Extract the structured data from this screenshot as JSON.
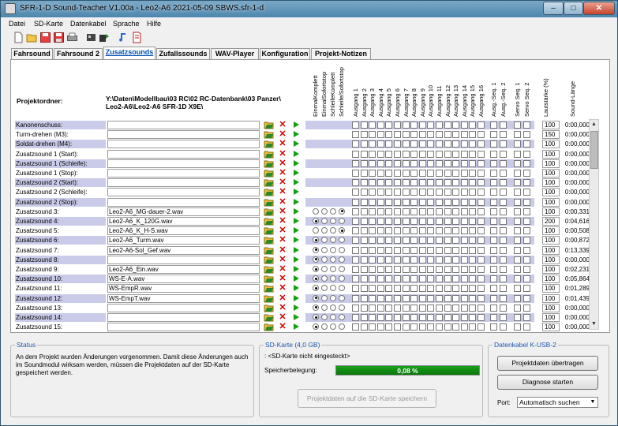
{
  "window": {
    "title": "SFR-1-D Sound-Teacher V1.00a - Leo2-A6 2021-05-09 SBWS.sfr-1-d",
    "min_label": "–",
    "max_label": "□",
    "close_label": "✕"
  },
  "menu": [
    "Datei",
    "SD-Karte",
    "Datenkabel",
    "Sprache",
    "Hilfe"
  ],
  "toolbar_icons": [
    "new-file-icon",
    "open-folder-icon",
    "save-icon",
    "save-as-icon",
    "print-icon",
    "module-icon",
    "export-icon",
    "music-note-icon",
    "document-icon"
  ],
  "tabs": [
    {
      "label": "Fahrsound",
      "active": false
    },
    {
      "label": "Fahrsound 2",
      "active": false
    },
    {
      "label": "Zusatzsounds",
      "active": true
    },
    {
      "label": "Zufallssounds",
      "active": false
    },
    {
      "label": "WAV-Player",
      "active": false
    },
    {
      "label": "Konfiguration",
      "active": false
    },
    {
      "label": "Projekt-Notizen",
      "active": false
    }
  ],
  "project": {
    "label": "Projektordner:",
    "path_line1": "Y:\\Daten\\Modellbau\\03 RC\\02 RC-Datenbank\\03 Panzer\\",
    "path_line2": "Leo2-A6\\Leo2-A6 SFR-1D X9E\\"
  },
  "headers": {
    "modes": [
      "EinmalKomplett",
      "EinmalSofortstop",
      "SchleifeKomplett",
      "Schleife/Sofortstop"
    ],
    "ausgang": [
      "Ausgang 1",
      "Ausgang 2",
      "Ausgang 3",
      "Ausgang 4",
      "Ausgang 5",
      "Ausgang 6",
      "Ausgang 7",
      "Ausgang 8",
      "Ausgang 9",
      "Ausgang 10",
      "Ausgang 11",
      "Ausgang 12",
      "Ausgang 13",
      "Ausgang 14",
      "Ausgang 15",
      "Ausgang 16"
    ],
    "ausgseq": [
      "Ausg.-Seq. 1",
      "Ausg.-Seq. 2"
    ],
    "servoseq": [
      "Servo Seq. 1",
      "Servo Seq. 2"
    ],
    "volume": "Lautstärke (%)",
    "length": "Sound-Länge"
  },
  "rows": [
    {
      "label": "Kanonenschuss:",
      "file": "",
      "mode": null,
      "volume": "100",
      "length": "0:00,000"
    },
    {
      "label": "Turm-drehen (M3):",
      "file": "",
      "mode": null,
      "volume": "150",
      "length": "0:00,000"
    },
    {
      "label": "Soldat-drehen (M4):",
      "file": "",
      "mode": null,
      "volume": "100",
      "length": "0:00,000"
    },
    {
      "label": "Zusatzsound 1 (Start):",
      "file": "",
      "mode": null,
      "volume": "100",
      "length": "0:00,000"
    },
    {
      "label": "Zusatzsound 1 (Schleife):",
      "file": "",
      "mode": null,
      "volume": "100",
      "length": "0:00,000"
    },
    {
      "label": "Zusatzsound 1 (Stop):",
      "file": "",
      "mode": null,
      "volume": "100",
      "length": "0:00,000"
    },
    {
      "label": "Zusatzsound 2 (Start):",
      "file": "",
      "mode": null,
      "volume": "100",
      "length": "0:00,000"
    },
    {
      "label": "Zusatzsound 2 (Schleife):",
      "file": "",
      "mode": null,
      "volume": "100",
      "length": "0:00,000"
    },
    {
      "label": "Zusatzsound 2 (Stop):",
      "file": "",
      "mode": null,
      "volume": "100",
      "length": "0:00,000"
    },
    {
      "label": "Zusatzsound 3:",
      "file": "Leo2-A6_MG-dauer-2.wav",
      "mode": 3,
      "volume": "100",
      "length": "0:00,331"
    },
    {
      "label": "Zusatzsound 4:",
      "file": "Leo2-A6_K_120G.wav",
      "mode": 0,
      "volume": "200",
      "length": "0:04,616"
    },
    {
      "label": "Zusatzsound 5:",
      "file": "Leo2-A6_K_H-S.wav",
      "mode": 3,
      "volume": "100",
      "length": "0:00,508"
    },
    {
      "label": "Zusatzsound 6:",
      "file": "Leo2-A6_Turm.wav",
      "mode": 0,
      "volume": "100",
      "length": "0:00,872"
    },
    {
      "label": "Zusatzsound 7:",
      "file": "Leo2-A6-Sol_Gef.wav",
      "mode": 0,
      "volume": "100",
      "length": "0:13,339"
    },
    {
      "label": "Zusatzsound 8:",
      "file": "",
      "mode": 0,
      "volume": "100",
      "length": "0:00,000"
    },
    {
      "label": "Zusatzsound 9:",
      "file": "Leo2-A6_Ein.wav",
      "mode": 0,
      "volume": "100",
      "length": "0:02,231"
    },
    {
      "label": "Zusatzsound 10:",
      "file": "WS-E-A.wav",
      "mode": 0,
      "volume": "100",
      "length": "0:05,864"
    },
    {
      "label": "Zusatzsound 11:",
      "file": "WS-EmpR.wav",
      "mode": 0,
      "volume": "100",
      "length": "0:01,289"
    },
    {
      "label": "Zusatzsound 12:",
      "file": "WS-EmpT.wav",
      "mode": 0,
      "volume": "100",
      "length": "0:01,439"
    },
    {
      "label": "Zusatzsound 13:",
      "file": "",
      "mode": 0,
      "volume": "100",
      "length": "0:00,000"
    },
    {
      "label": "Zusatzsound 14:",
      "file": "",
      "mode": 0,
      "volume": "100",
      "length": "0:00,000"
    },
    {
      "label": "Zusatzsound 15:",
      "file": "",
      "mode": 0,
      "volume": "100",
      "length": "0:00,000"
    }
  ],
  "status": {
    "title": "Status",
    "text": "An dem Projekt wurden Änderungen vorgenommen. Damit diese Änderungen auch im Soundmodul wirksam werden, müssen die Projektdaten auf der SD-Karte gespeichert werden."
  },
  "sdcard": {
    "title": "SD-Karte (4,0 GB)",
    "state": ": <SD-Karte nicht eingesteckt>",
    "usage_label": "Speicherbelegung:",
    "usage_value": "0,08 %",
    "usage_fraction": 1.0,
    "save_button": "Projektdaten auf die SD-Karte speichern"
  },
  "cable": {
    "title": "Datenkabel K-USB-2",
    "transfer_button": "Projektdaten übertragen",
    "diagnose_button": "Diagnose starten",
    "port_label": "Port:",
    "port_value": "Automatisch suchen"
  },
  "colors": {
    "shade": "#c9cbe8",
    "progress": "#0a760a",
    "delete": "#d00000",
    "play": "#10a010"
  }
}
